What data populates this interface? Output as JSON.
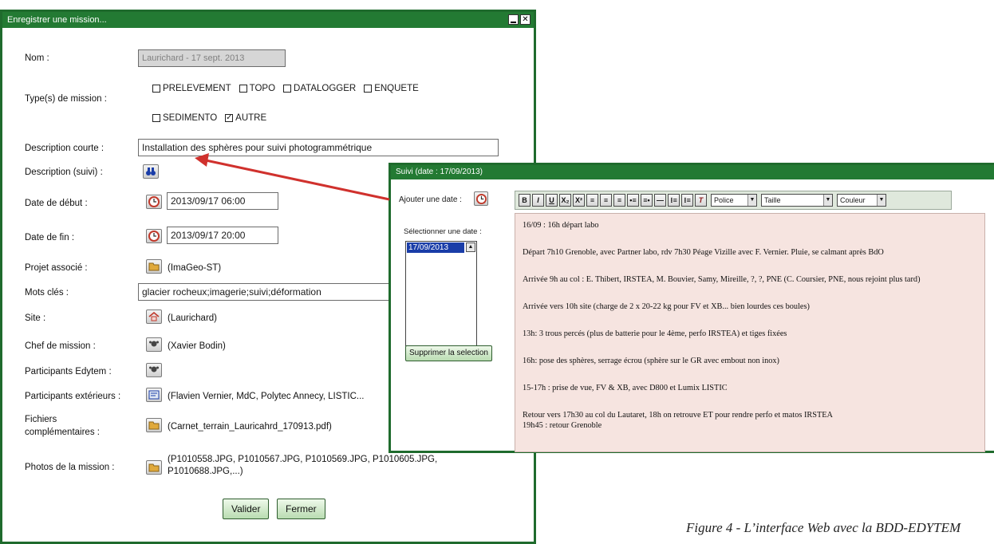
{
  "main_window": {
    "title": "Enregistrer une mission...",
    "fields": {
      "nom_label": "Nom :",
      "nom_value": "Laurichard - 17 sept. 2013",
      "types_label": "Type(s) de mission :",
      "types": [
        {
          "label": "PRELEVEMENT",
          "checked": false
        },
        {
          "label": "TOPO",
          "checked": false
        },
        {
          "label": "DATALOGGER",
          "checked": false
        },
        {
          "label": "ENQUETE",
          "checked": false
        },
        {
          "label": "SEDIMENTO",
          "checked": false
        },
        {
          "label": "AUTRE",
          "checked": true
        }
      ],
      "desc_courte_label": "Description courte :",
      "desc_courte_value": "Installation des sphères pour suivi photogrammétrique",
      "desc_suivi_label": "Description (suivi) :",
      "date_debut_label": "Date de début :",
      "date_debut_value": "2013/09/17 06:00",
      "date_fin_label": "Date de fin :",
      "date_fin_value": "2013/09/17 20:00",
      "projet_label": "Projet associé :",
      "projet_value": "(ImaGeo-ST)",
      "mots_cles_label": "Mots clés :",
      "mots_cles_value": "glacier rocheux;imagerie;suivi;déformation",
      "site_label": "Site :",
      "site_value": "(Laurichard)",
      "chef_label": "Chef de mission :",
      "chef_value": "(Xavier Bodin)",
      "participants_edytem_label": "Participants Edytem :",
      "participants_ext_label": "Participants extérieurs :",
      "participants_ext_value": "(Flavien Vernier, MdC, Polytec Annecy, LISTIC...",
      "fichiers_label_1": "Fichiers",
      "fichiers_label_2": "complémentaires :",
      "fichiers_value": "(Carnet_terrain_Lauricahrd_170913.pdf)",
      "photos_label": "Photos de la mission :",
      "photos_value_1": "(P1010558.JPG, P1010567.JPG, P1010569.JPG, P1010605.JPG,",
      "photos_value_2": "P1010688.JPG,...)"
    },
    "buttons": {
      "valider": "Valider",
      "fermer": "Fermer"
    }
  },
  "suivi_window": {
    "title": "Suivi (date : 17/09/2013)",
    "ajouter_label": "Ajouter une date :",
    "select_label": "Sélectionner une date :",
    "dates": [
      "17/09/2013"
    ],
    "supprimer_button": "Supprimer la selection",
    "toolbar": {
      "buttons": [
        "B",
        "I",
        "U",
        "X₂",
        "X²",
        "≡",
        "≡",
        "≡",
        "•≡",
        "≡•",
        "—",
        "⁝≡",
        "⁝≡",
        "T"
      ],
      "police": "Police",
      "taille": "Taille",
      "couleur": "Couleur"
    },
    "entries": [
      "16/09 : 16h départ labo",
      "Départ 7h10 Grenoble, avec Partner labo, rdv 7h30 Péage Vizille avec F. Vernier. Pluie, se calmant après BdO",
      "Arrivée 9h au col : E. Thibert, IRSTEA, M. Bouvier, Samy, Mireille, ?, ?, PNE (C. Coursier, PNE, nous rejoint plus tard)",
      "Arrivée vers 10h site (charge de 2 x 20-22 kg pour FV et XB... bien lourdes ces boules)",
      "13h: 3 trous percés (plus de batterie pour le 4ème, perfo IRSTEA) et tiges fixées",
      "16h: pose des sphères, serrage écrou (sphère sur le GR avec embout non inox)",
      "15-17h : prise de vue, FV & XB, avec D800 et Lumix LISTIC",
      "Retour vers 17h30 au col du Lautaret, 18h on retrouve ET pour rendre perfo et matos IRSTEA",
      "19h45 : retour Grenoble"
    ]
  },
  "caption": "Figure 4 - L’interface Web avec la BDD-EDYTEM",
  "colors": {
    "titlebar": "#237a33",
    "arrow": "#d0312d",
    "editor_bg": "#f6e4e0"
  }
}
